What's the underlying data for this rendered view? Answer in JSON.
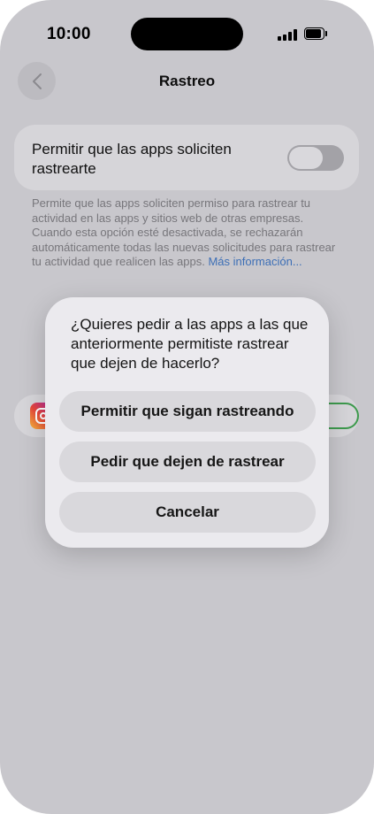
{
  "status_bar": {
    "time": "10:00"
  },
  "nav": {
    "title": "Rastreo"
  },
  "tracking_setting": {
    "label": "Permitir que las apps soliciten rastrearte",
    "toggle_on": false
  },
  "footnote": {
    "text": "Permite que las apps soliciten permiso para rastrear tu actividad en las apps y sitios web de otras empresas. Cuando esta opción esté desactivada, se rechazarán automáticamente todas las nuevas solicitudes para rastrear tu actividad que realicen las apps. ",
    "link": "Más información..."
  },
  "alert": {
    "message": "¿Quieres pedir a las apps a las que anteriormente permitiste rastrear que dejen de hacerlo?",
    "buttons": [
      {
        "label": "Permitir que sigan rastreando"
      },
      {
        "label": "Pedir que dejen de rastrear"
      },
      {
        "label": "Cancelar"
      }
    ]
  },
  "colors": {
    "dimmed_background": "#c8c7cc",
    "alert_background": "#ebeaee",
    "link": "#3d6fb6",
    "toggle_on_accent": "#3d9a4d"
  },
  "icons": [
    "back-chevron-icon",
    "signal-icon",
    "battery-icon",
    "instagram-icon"
  ]
}
